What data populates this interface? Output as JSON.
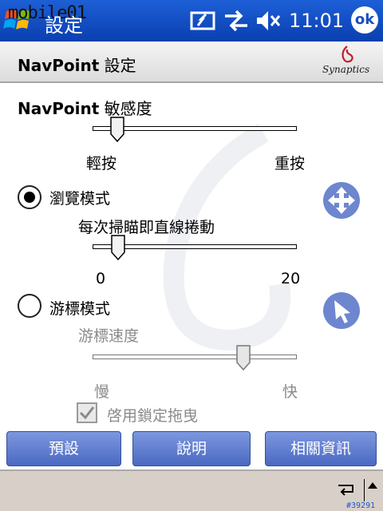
{
  "titlebar": {
    "watermark": "mobile01",
    "title": "設定",
    "clock": "11:01",
    "ok_label": "ok"
  },
  "header": {
    "title_bold": "NavPoint",
    "title_rest": " 設定",
    "brand": "Synaptics"
  },
  "sensitivity": {
    "title_bold": "NavPoint",
    "title_rest": " 敏感度",
    "min_label": "輕按",
    "max_label": "重按",
    "value_percent": 12
  },
  "browse_mode": {
    "label": "瀏覽模式",
    "selected": true,
    "scroll_label": "每次掃瞄即直線捲動",
    "min_label": "0",
    "max_label": "20",
    "value": 1
  },
  "cursor_mode": {
    "label": "游標模式",
    "selected": false,
    "speed_label": "游標速度",
    "min_label": "慢",
    "max_label": "快",
    "value_percent": 74,
    "drag_lock_label": "啓用鎖定拖曳",
    "drag_lock_checked": true
  },
  "buttons": {
    "default": "預設",
    "help": "說明",
    "related": "相關資訊"
  },
  "footer": {
    "tag": "#39291"
  }
}
